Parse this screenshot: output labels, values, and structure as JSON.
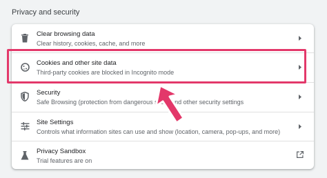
{
  "section_title": "Privacy and security",
  "rows": [
    {
      "title": "Clear browsing data",
      "subtitle": "Clear history, cookies, cache, and more",
      "icon": "trash-icon",
      "trailing": "chevron-right-icon"
    },
    {
      "title": "Cookies and other site data",
      "subtitle": "Third-party cookies are blocked in Incognito mode",
      "icon": "cookie-icon",
      "trailing": "chevron-right-icon"
    },
    {
      "title": "Security",
      "subtitle": "Safe Browsing (protection from dangerous sites) and other security settings",
      "icon": "shield-icon",
      "trailing": "chevron-right-icon"
    },
    {
      "title": "Site Settings",
      "subtitle": "Controls what information sites can use and show (location, camera, pop-ups, and more)",
      "icon": "sliders-icon",
      "trailing": "chevron-right-icon"
    },
    {
      "title": "Privacy Sandbox",
      "subtitle": "Trial features are on",
      "icon": "flask-icon",
      "trailing": "open-in-new-icon"
    }
  ],
  "colors": {
    "highlight": "#e3386a",
    "arrow": "#e3386a",
    "icon": "#5f6368"
  }
}
